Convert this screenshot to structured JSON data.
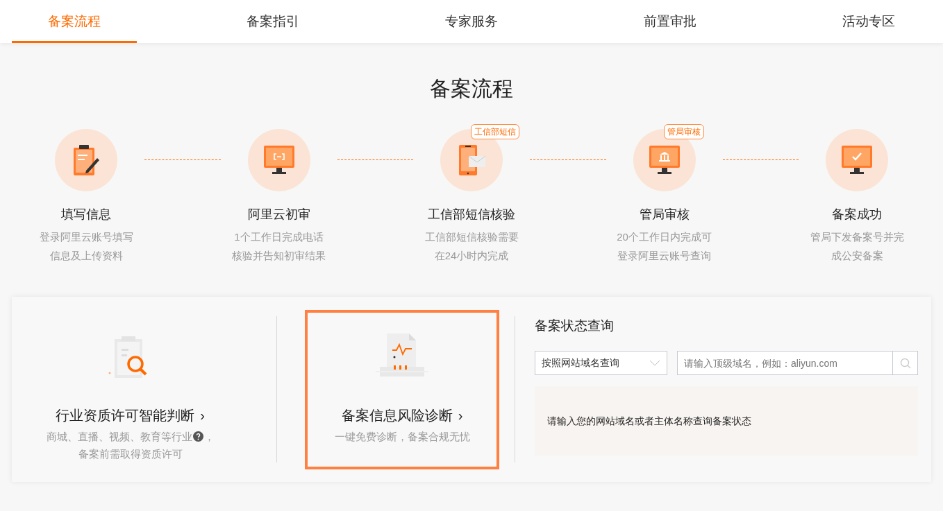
{
  "tabs": [
    {
      "label": "备案流程",
      "selected": true
    },
    {
      "label": "备案指引",
      "selected": false
    },
    {
      "label": "专家服务",
      "selected": false
    },
    {
      "label": "前置审批",
      "selected": false
    },
    {
      "label": "活动专区",
      "selected": false
    }
  ],
  "heading": "备案流程",
  "steps": [
    {
      "kind": "clipboard",
      "title": "填写信息",
      "lines": [
        "登录阿里云账号填写",
        "信息及上传资料"
      ]
    },
    {
      "kind": "monitor-code",
      "title": "阿里云初审",
      "lines": [
        "1个工作日完成电话",
        "核验并告知初审结果"
      ]
    },
    {
      "kind": "phone-mail",
      "badge": "工信部短信",
      "title": "工信部短信核验",
      "lines": [
        "工信部短信核验需要",
        "在24小时内完成"
      ]
    },
    {
      "kind": "monitor-bank",
      "badge": "管局审核",
      "title": "管局审核",
      "lines": [
        "20个工作日内完成可",
        "登录阿里云账号查询"
      ]
    },
    {
      "kind": "monitor-check",
      "title": "备案成功",
      "lines": [
        "管局下发备案号并完",
        "成公安备案"
      ]
    }
  ],
  "tools": [
    {
      "kind": "license",
      "title": "行业资质许可智能判断",
      "chevron": "›",
      "lines": [
        "商城、直播、视频、教育等行业",
        "，",
        "备案前需取得资质许可"
      ],
      "selected": false
    },
    {
      "kind": "diagnosis",
      "title": "备案信息风险诊断",
      "chevron": "›",
      "lines": [
        "一键免费诊断，备案合规无忧"
      ],
      "selected": true
    }
  ],
  "status_query": {
    "title": "备案状态查询",
    "query_type": "按照网站域名查询",
    "placeholder": "请输入顶级域名，例如：aliyun.com",
    "result_message": "请输入您的网站域名或者主体名称查询备案状态"
  }
}
